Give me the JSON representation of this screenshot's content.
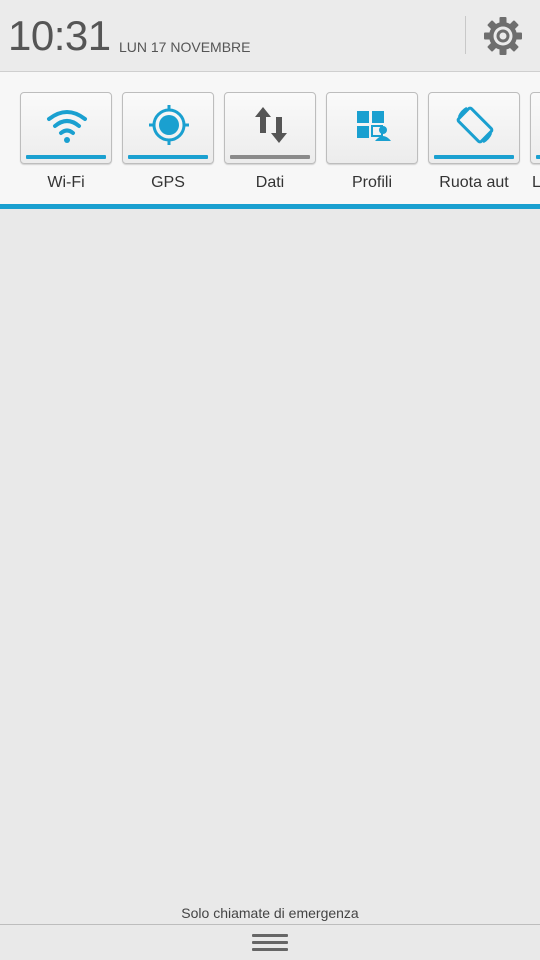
{
  "status": {
    "time": "10:31",
    "date": "LUN 17 NOVEMBRE"
  },
  "colors": {
    "accent": "#1aa0d0",
    "inactive": "#8a8a8a"
  },
  "toggles": [
    {
      "label": "Wi-Fi",
      "icon": "wifi-icon",
      "active": true
    },
    {
      "label": "GPS",
      "icon": "gps-icon",
      "active": true
    },
    {
      "label": "Dati",
      "icon": "data-transfer-icon",
      "active": false
    },
    {
      "label": "Profili",
      "icon": "profiles-icon",
      "active": false
    },
    {
      "label": "Ruota aut",
      "icon": "auto-rotate-icon",
      "active": true
    },
    {
      "label": "L",
      "icon": "partial-icon",
      "active": true
    }
  ],
  "footer": {
    "emergency_text": "Solo chiamate di emergenza"
  }
}
